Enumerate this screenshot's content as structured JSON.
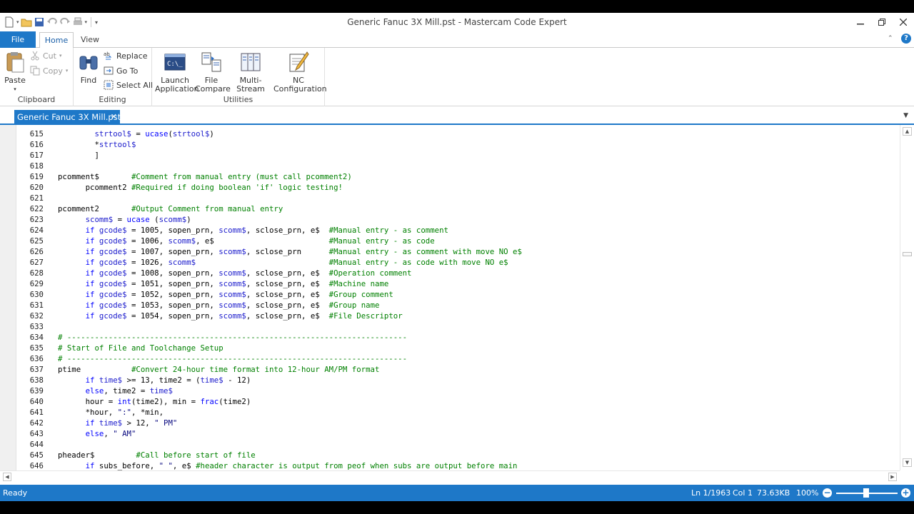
{
  "window": {
    "title": "Generic Fanuc 3X Mill.pst - Mastercam Code Expert"
  },
  "ribbon_tabs": [
    "File",
    "Home",
    "View"
  ],
  "ribbon": {
    "clipboard": {
      "label": "Clipboard",
      "paste": "Paste",
      "cut": "Cut",
      "copy": "Copy"
    },
    "editing": {
      "label": "Editing",
      "find": "Find",
      "replace": "Replace",
      "goto": "Go To",
      "select_all": "Select All"
    },
    "utilities": {
      "label": "Utilities",
      "launch_app_1": "Launch",
      "launch_app_2": "Application",
      "file_compare_1": "File",
      "file_compare_2": "Compare",
      "multi_stream": "Multi-Stream",
      "nc_config_1": "NC",
      "nc_config_2": "Configuration"
    }
  },
  "doc_tab": {
    "name": "Generic Fanuc 3X Mill.pst",
    "close": "✕"
  },
  "editor": {
    "lines": [
      {
        "n": "615",
        "t": "        strtool$ = ucase(strtool$)"
      },
      {
        "n": "616",
        "t": "        *strtool$"
      },
      {
        "n": "617",
        "t": "        ]"
      },
      {
        "n": "618",
        "t": ""
      },
      {
        "n": "619",
        "t": "pcomment$       #Comment from manual entry (must call pcomment2)"
      },
      {
        "n": "620",
        "t": "      pcomment2 #Required if doing boolean 'if' logic testing!"
      },
      {
        "n": "621",
        "t": ""
      },
      {
        "n": "622",
        "t": "pcomment2       #Output Comment from manual entry"
      },
      {
        "n": "623",
        "t": "      scomm$ = ucase (scomm$)"
      },
      {
        "n": "624",
        "t": "      if gcode$ = 1005, sopen_prn, scomm$, sclose_prn, e$  #Manual entry - as comment"
      },
      {
        "n": "625",
        "t": "      if gcode$ = 1006, scomm$, e$                         #Manual entry - as code"
      },
      {
        "n": "626",
        "t": "      if gcode$ = 1007, sopen_prn, scomm$, sclose_prn      #Manual entry - as comment with move NO e$"
      },
      {
        "n": "627",
        "t": "      if gcode$ = 1026, scomm$                             #Manual entry - as code with move NO e$"
      },
      {
        "n": "628",
        "t": "      if gcode$ = 1008, sopen_prn, scomm$, sclose_prn, e$  #Operation comment"
      },
      {
        "n": "629",
        "t": "      if gcode$ = 1051, sopen_prn, scomm$, sclose_prn, e$  #Machine name"
      },
      {
        "n": "630",
        "t": "      if gcode$ = 1052, sopen_prn, scomm$, sclose_prn, e$  #Group comment"
      },
      {
        "n": "631",
        "t": "      if gcode$ = 1053, sopen_prn, scomm$, sclose_prn, e$  #Group name"
      },
      {
        "n": "632",
        "t": "      if gcode$ = 1054, sopen_prn, scomm$, sclose_prn, e$  #File Descriptor"
      },
      {
        "n": "633",
        "t": ""
      },
      {
        "n": "634",
        "t": "# --------------------------------------------------------------------------"
      },
      {
        "n": "635",
        "t": "# Start of File and Toolchange Setup"
      },
      {
        "n": "636",
        "t": "# --------------------------------------------------------------------------"
      },
      {
        "n": "637",
        "t": "ptime           #Convert 24-hour time format into 12-hour AM/PM format"
      },
      {
        "n": "638",
        "t": "      if time$ >= 13, time2 = (time$ - 12)"
      },
      {
        "n": "639",
        "t": "      else, time2 = time$"
      },
      {
        "n": "640",
        "t": "      hour = int(time2), min = frac(time2)"
      },
      {
        "n": "641",
        "t": "      *hour, \":\", *min,"
      },
      {
        "n": "642",
        "t": "      if time$ > 12, \" PM\""
      },
      {
        "n": "643",
        "t": "      else, \" AM\""
      },
      {
        "n": "644",
        "t": ""
      },
      {
        "n": "645",
        "t": "pheader$         #Call before start of file"
      },
      {
        "n": "646",
        "t": "      if subs_before, \" \", e$ #header character is output from peof when subs are output before main"
      }
    ]
  },
  "status": {
    "ready": "Ready",
    "line": "Ln 1/1963",
    "col": "Col 1",
    "size": "73.63KB",
    "zoom": "100%"
  }
}
